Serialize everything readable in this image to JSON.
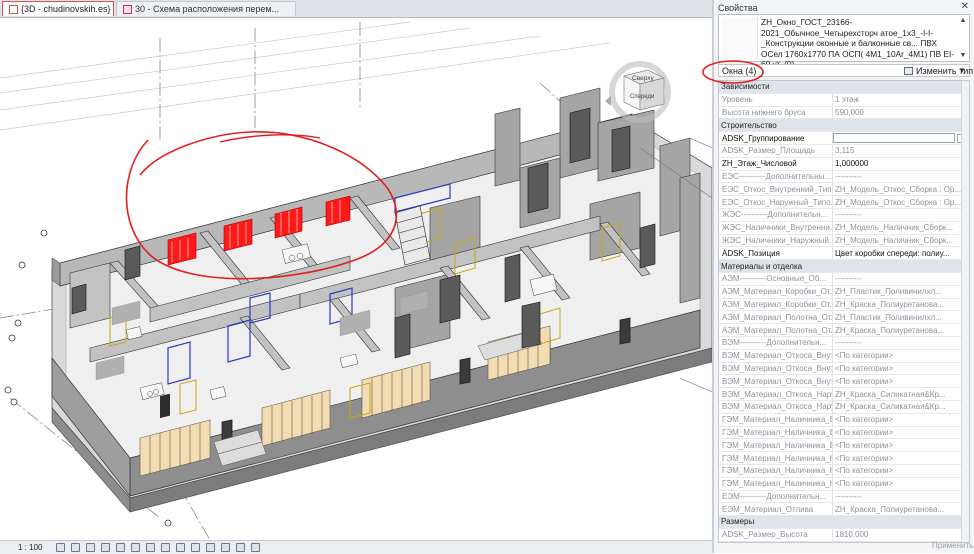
{
  "tabs": [
    {
      "label": "{3D - chudinovskih.es}"
    },
    {
      "label": "30 - Схема расположения перем..."
    }
  ],
  "status_bar": {
    "scale": "1 : 100"
  },
  "viewcube": {
    "top_label": "Сверху",
    "front_label": "Спереди"
  },
  "properties": {
    "title": "Свойства",
    "close": "✕",
    "type_name": "ZH_Окно_ГОСТ_23166-2021_Обычное_Четырехсторч атое_1х3_-I-I-_Конструкции оконные и балконные св... ПВХ ОСел 1760x1770 ПА ОСП( 4М1_10Ar_4М1) ПВ EI-60 ут. (0)",
    "selection": "Окна (4)",
    "edit_type": "Изменить тип",
    "apply": "Применить",
    "groups": [
      {
        "title": "Зависимости",
        "rows": [
          {
            "name": "Уровень",
            "value": "1 этаж",
            "dim": true
          },
          {
            "name": "Высота нижнего бруса",
            "value": "590,000",
            "dim": true
          }
        ]
      },
      {
        "title": "Строительство",
        "rows": [
          {
            "name": "ADSK_Группирование",
            "value": "",
            "dim": false,
            "editbox": true
          },
          {
            "name": "ADSK_Размер_Площадь",
            "value": "3,115",
            "dim": true
          },
          {
            "name": "ZH_Этаж_Числовой",
            "value": "1,000000",
            "dim": false
          },
          {
            "name": "ЕЭС----------Дополнительны...",
            "value": "----------",
            "dim": true
          },
          {
            "name": "ЕЭС_Откос_Внутренний_Типо...",
            "value": "ZH_Модель_Откос_Сборка : Ор...",
            "dim": true
          },
          {
            "name": "ЕЭС_Откос_Наружный_Типо...",
            "value": "ZH_Модель_Откос_Сборка : Ор...",
            "dim": true
          },
          {
            "name": "ЖЭС----------Дополнительн...",
            "value": "----------",
            "dim": true
          },
          {
            "name": "ЖЭС_Наличники_Внутренни...",
            "value": "ZH_Модель_Наличник_Сборк...",
            "dim": true
          },
          {
            "name": "ЖЭС_Наличники_Наружный...",
            "value": "ZH_Модель_Наличник_Сборк...",
            "dim": true
          },
          {
            "name": "ADSK_Позиция",
            "value": "Цвет коробки спереди: полиу...",
            "dim": false
          }
        ]
      },
      {
        "title": "Материалы и отделка",
        "rows": [
          {
            "name": "АЭМ----------Основные_Об...",
            "value": "----------",
            "dim": true
          },
          {
            "name": "АЭМ_Материал_Коробки_От...",
            "value": "ZH_Пластик_Поливинилхл...",
            "dim": true
          },
          {
            "name": "АЭМ_Материал_Коробки_От...",
            "value": "ZH_Краска_Полиуретанова...",
            "dim": true
          },
          {
            "name": "АЭМ_Материал_Полотна_От...",
            "value": "ZH_Пластик_Поливинилхл...",
            "dim": true
          },
          {
            "name": "АЭМ_Материал_Полотна_От...",
            "value": "ZH_Краска_Полиуретанова...",
            "dim": true
          },
          {
            "name": "ВЭМ----------Дополнительн...",
            "value": "----------",
            "dim": true
          },
          {
            "name": "ВЭМ_Материал_Откоса_Внут...",
            "value": "<По категории>",
            "dim": true
          },
          {
            "name": "ВЭМ_Материал_Откоса_Внут...",
            "value": "<По категории>",
            "dim": true
          },
          {
            "name": "ВЭМ_Материал_Откоса_Внут...",
            "value": "<По категории>",
            "dim": true
          },
          {
            "name": "ВЭМ_Материал_Откоса_Нару...",
            "value": "ZH_Краска_Силикатная&Кр...",
            "dim": true
          },
          {
            "name": "ВЭМ_Материал_Откоса_Нару...",
            "value": "ZH_Краска_Силикатная&Кр...",
            "dim": true
          },
          {
            "name": "ГЭМ_Материал_Наличника_В...",
            "value": "<По категории>",
            "dim": true
          },
          {
            "name": "ГЭМ_Материал_Наличника_В...",
            "value": "<По категории>",
            "dim": true
          },
          {
            "name": "ГЭМ_Материал_Наличника_В...",
            "value": "<По категории>",
            "dim": true
          },
          {
            "name": "ГЭМ_Материал_Наличника_Н...",
            "value": "<По категории>",
            "dim": true
          },
          {
            "name": "ГЭМ_Материал_Наличника_Н...",
            "value": "<По категории>",
            "dim": true
          },
          {
            "name": "ГЭМ_Материал_Наличника_Н...",
            "value": "<По категории>",
            "dim": true
          },
          {
            "name": "ЕЭМ----------Дополнительн...",
            "value": "----------",
            "dim": true
          },
          {
            "name": "ЕЭМ_Материал_Отлива",
            "value": "ZH_Краска_Полиуретанова...",
            "dim": true
          }
        ]
      },
      {
        "title": "Размеры",
        "rows": [
          {
            "name": "ADSK_Размер_Высота",
            "value": "1810,000",
            "dim": true
          }
        ]
      }
    ]
  },
  "colors": {
    "annotation": "#e02020",
    "tab_border": "#d9534f",
    "window_highlight": "#ff1a1a"
  }
}
